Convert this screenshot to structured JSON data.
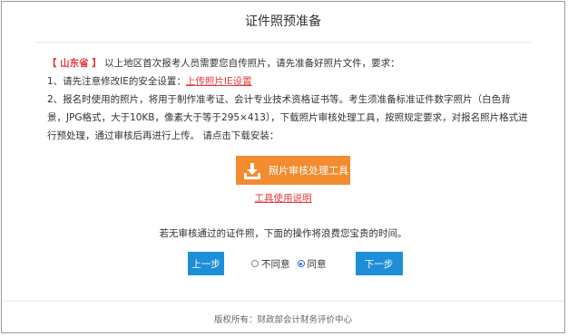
{
  "page": {
    "title": "证件照预准备"
  },
  "instructions": {
    "region_label": "【 山东省 】",
    "line1_text": "以上地区首次报考人员需要您自传照片，请先准备好照片文件，要求：",
    "line2_prefix": "1、请先注意修改IE的安全设置：",
    "line2_link": "上传照片IE设置",
    "line3_text": "2、报名时使用的照片，将用于制作准考证、会计专业技术资格证书等。考生须准备标准证件数字照片（白色背景，JPG格式，大于10KB，像素大于等于295×413），下载照片审核处理工具，按照规定要求，对报名照片格式进行预处理，通过审核后再进行上传。 请点击下载安装："
  },
  "download": {
    "button_label": "照片审核处理工具",
    "icon": "download-icon",
    "tool_doc_link": "工具使用说明"
  },
  "notice": {
    "text": "若无审核通过的证件照，下面的操作将浪费您宝贵的时间。"
  },
  "actions": {
    "prev_label": "上一步",
    "disagree_label": "不同意",
    "agree_label": "同意",
    "next_label": "下一步",
    "selected": "同意"
  },
  "footer": {
    "copyright": "版权所有：财政部会计财务评价中心"
  },
  "colors": {
    "accent_orange": "#f38b2f",
    "accent_blue": "#1e8ed8",
    "warning_red": "#e4393c"
  }
}
